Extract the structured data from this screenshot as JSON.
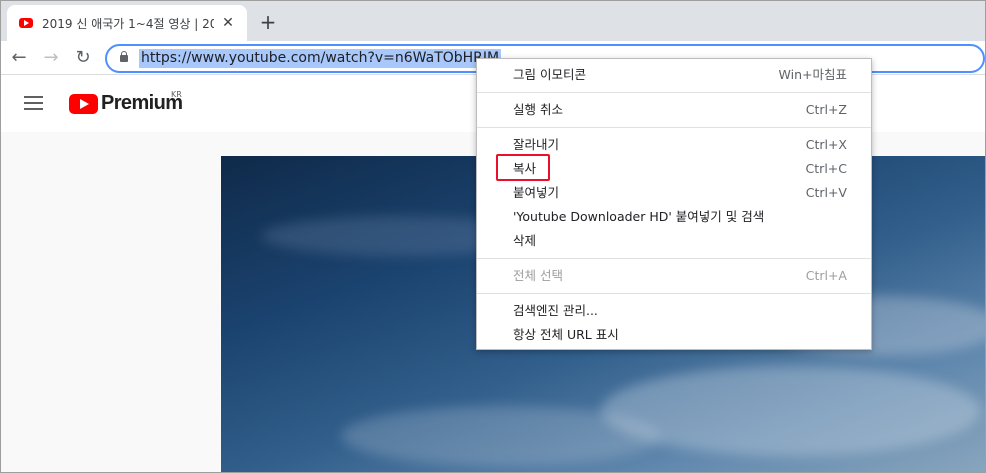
{
  "browser": {
    "tab": {
      "title": "2019 신 애국가 1~4절 영상 | 20",
      "close_glyph": "✕"
    },
    "new_tab_glyph": "+",
    "nav": {
      "back_glyph": "←",
      "forward_glyph": "→",
      "reload_glyph": "↻"
    },
    "url": "https://www.youtube.com/watch?v=n6WaTObHRJM"
  },
  "youtube": {
    "brand": "Premium",
    "region": "KR"
  },
  "context_menu": {
    "emoji": {
      "label": "그림 이모티콘",
      "shortcut": "Win+마침표"
    },
    "undo": {
      "label": "실행 취소",
      "shortcut": "Ctrl+Z"
    },
    "cut": {
      "label": "잘라내기",
      "shortcut": "Ctrl+X"
    },
    "copy": {
      "label": "복사",
      "shortcut": "Ctrl+C"
    },
    "paste": {
      "label": "붙여넣기",
      "shortcut": "Ctrl+V"
    },
    "paste_search": {
      "label": "'Youtube Downloader HD' 붙여넣기 및 검색"
    },
    "delete": {
      "label": "삭제"
    },
    "select_all": {
      "label": "전체 선택",
      "shortcut": "Ctrl+A"
    },
    "manage_search": {
      "label": "검색엔진 관리..."
    },
    "show_full_url": {
      "label": "항상 전체 URL 표시"
    }
  },
  "colors": {
    "highlight_border": "#e8102a",
    "youtube_red": "#ff0000",
    "omnibox_focus": "#4d90fe",
    "url_selection": "#a8c7fa"
  }
}
